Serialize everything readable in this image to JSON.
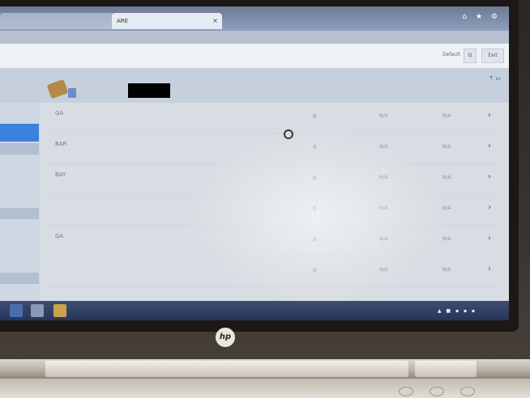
{
  "browser": {
    "tab_active_title": "ARE",
    "tab_close": "×",
    "window_controls": "⌂ ★ ⚙"
  },
  "appbar": {
    "search_text": "Default",
    "search_button": "Q",
    "exit_button": "Exit"
  },
  "status": {
    "icons": "⇡ ▭"
  },
  "table": {
    "rows": [
      {
        "name": "GA",
        "n": "0",
        "a": "N/A",
        "b": "N/A",
        "chev": "›"
      },
      {
        "name": "BAR",
        "n": "0",
        "a": "N/A",
        "b": "N/A",
        "chev": "›"
      },
      {
        "name": "BAY",
        "n": "0",
        "a": "N/A",
        "b": "N/A",
        "chev": "›"
      },
      {
        "name": "",
        "n": "0",
        "a": "N/A",
        "b": "N/A",
        "chev": "›"
      },
      {
        "name": "GA",
        "n": "0",
        "a": "N/A",
        "b": "N/A",
        "chev": "›"
      },
      {
        "name": "",
        "n": "0",
        "a": "N/A",
        "b": "N/A",
        "chev": "›"
      }
    ]
  },
  "laptop": {
    "logo": "hp"
  }
}
